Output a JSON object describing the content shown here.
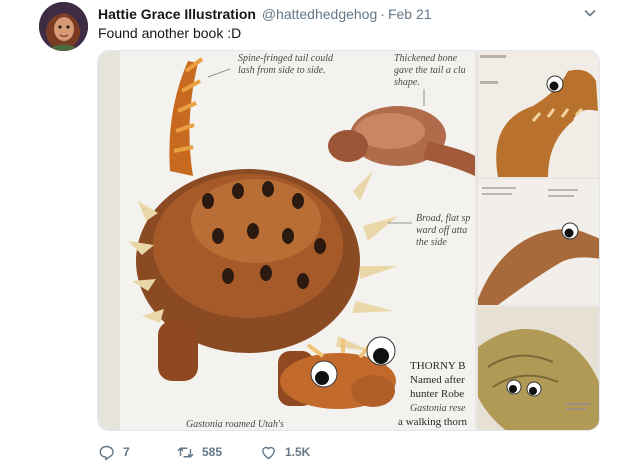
{
  "tweet": {
    "author": {
      "display_name": "Hattie Grace Illustration",
      "handle": "@hattedhedgehog",
      "separator": "·",
      "timestamp": "Feb 21"
    },
    "text": "Found another book :D",
    "media": {
      "main_image": {
        "labels": {
          "tail_caption_1": "Spine-fringed tail could",
          "tail_caption_2": "lash from side to side.",
          "bone_caption_1": "Thickened bone",
          "bone_caption_2": "gave the tail a clu",
          "bone_caption_3": "shape.",
          "flat_caption_1": "Broad, flat sp",
          "flat_caption_2": "ward off atta",
          "flat_caption_3": "the side",
          "heading": "THORNY B",
          "body_1": "Named after",
          "body_2": "hunter Robe",
          "body_3": "Gastonia rese",
          "body_4": "a walking thorn",
          "footer": "Gastonia roamed Utah's"
        }
      }
    },
    "actions": {
      "reply_count": "7",
      "retweet_count": "585",
      "like_count": "1.5K"
    },
    "icons": {
      "reply": "reply-icon",
      "retweet": "retweet-icon",
      "like": "heart-icon",
      "caret": "chevron-down-icon"
    },
    "colors": {
      "text_primary": "#14171a",
      "text_secondary": "#657786",
      "dinosaur_orange": "#c66a2a"
    }
  }
}
